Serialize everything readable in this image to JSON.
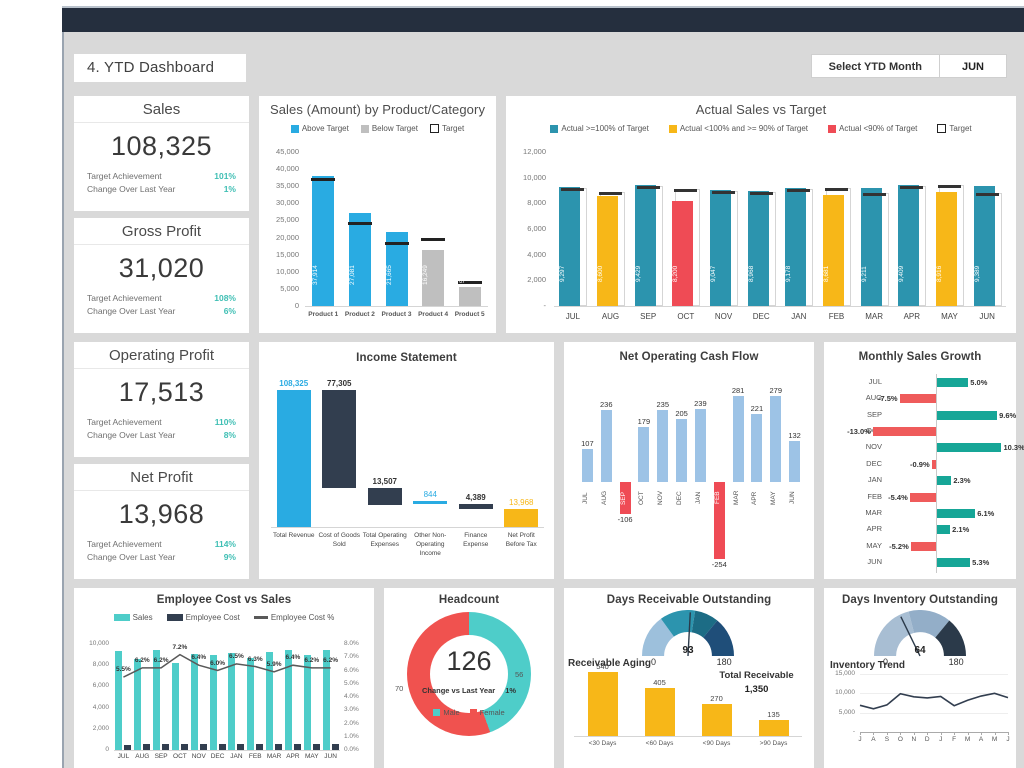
{
  "header": {
    "dashboard_title": "4. YTD Dashboard",
    "select_month_label": "Select YTD Month",
    "selected_month": "JUN"
  },
  "kpis": [
    {
      "name": "Sales",
      "value": "108,325",
      "target_label": "Target Achievement",
      "target_value": "101%",
      "change_label": "Change Over Last Year",
      "change_value": "1%"
    },
    {
      "name": "Gross Profit",
      "value": "31,020",
      "target_label": "Target Achievement",
      "target_value": "108%",
      "change_label": "Change Over Last Year",
      "change_value": "6%"
    },
    {
      "name": "Operating Profit",
      "value": "17,513",
      "target_label": "Target Achievement",
      "target_value": "110%",
      "change_label": "Change Over Last Year",
      "change_value": "8%"
    },
    {
      "name": "Net Profit",
      "value": "13,968",
      "target_label": "Target Achievement",
      "target_value": "114%",
      "change_label": "Change Over Last Year",
      "change_value": "9%"
    }
  ],
  "colors": {
    "blue": "#29abe2",
    "teal": "#2c94ae",
    "amber": "#f7b718",
    "red": "#ef4b55",
    "dark": "#323e4f",
    "green_teal": "#16a697",
    "cyan": "#4ecdc9",
    "light_blue": "#9dc3e6",
    "gray": "#bfbfbf",
    "navy": "#1f4e79"
  },
  "chart_data": [
    {
      "id": "sales-by-product",
      "type": "bar",
      "title": "Sales (Amount) by Product/Category",
      "legend": [
        "Above Target",
        "Below Target",
        "Target"
      ],
      "legend_position": "top",
      "categories": [
        "Product 1",
        "Product 2",
        "Product 3",
        "Product 4",
        "Product 5"
      ],
      "values": [
        37914,
        27081,
        21665,
        16249,
        5416
      ],
      "value_labels": [
        "37,914",
        "27,081",
        "21,665",
        "16,249",
        "5,416"
      ],
      "targets": [
        37500,
        24400,
        18600,
        19800,
        7300
      ],
      "status": [
        "above",
        "above",
        "above",
        "below",
        "below"
      ],
      "ylabel": "",
      "xlabel": "",
      "ylim": [
        0,
        45000
      ],
      "yticks": [
        "45,000",
        "40,000",
        "35,000",
        "30,000",
        "25,000",
        "20,000",
        "15,000",
        "10,000",
        "5,000",
        "0"
      ],
      "grid": false
    },
    {
      "id": "actual-sales-vs-target",
      "type": "bar",
      "title": "Actual Sales vs Target",
      "legend": [
        "Actual >=100% of Target",
        "Actual <100% and >= 90% of Target",
        "Actual <90% of Target",
        "Target"
      ],
      "legend_position": "top",
      "categories": [
        "JUL",
        "AUG",
        "SEP",
        "OCT",
        "NOV",
        "DEC",
        "JAN",
        "FEB",
        "MAR",
        "APR",
        "MAY",
        "JUN"
      ],
      "values": [
        9297,
        8600,
        9429,
        8200,
        9047,
        8968,
        9178,
        8681,
        9211,
        9409,
        8916,
        9389
      ],
      "value_labels": [
        "9,297",
        "8,600",
        "9,429",
        "8,200",
        "9,047",
        "8,968",
        "9,178",
        "8,681",
        "9,211",
        "9,409",
        "8,916",
        "9,389"
      ],
      "targets": [
        9180,
        8880,
        9340,
        9150,
        8960,
        8900,
        9120,
        9200,
        8830,
        9380,
        9440,
        8830
      ],
      "status": [
        "above",
        "mid",
        "above",
        "below",
        "above",
        "above",
        "above",
        "mid",
        "above",
        "above",
        "mid",
        "above"
      ],
      "ylim": [
        0,
        12000
      ],
      "yticks": [
        "12,000",
        "10,000",
        "8,000",
        "6,000",
        "4,000",
        "2,000",
        "-"
      ],
      "grid": false
    },
    {
      "id": "income-statement",
      "type": "bar",
      "title": "Income Statement",
      "categories": [
        "Total Revenue",
        "Cost of Goods Sold",
        "Total Operating Expenses",
        "Other Non-Operating Income",
        "Finance Expense",
        "Net Profit Before Tax"
      ],
      "values": [
        108325,
        77305,
        13507,
        844,
        4389,
        13968
      ],
      "value_labels": [
        "108,325",
        "77,305",
        "13,507",
        "844",
        "4,389",
        "13,968"
      ],
      "bar_colors": [
        "#29abe2",
        "#323e4f",
        "#323e4f",
        "#29abe2",
        "#323e4f",
        "#f7b718"
      ],
      "waterfall_base": [
        0,
        31020,
        17513,
        18357,
        13968,
        0
      ],
      "ylim": [
        0,
        108325
      ],
      "grid": false
    },
    {
      "id": "net-operating-cash-flow",
      "type": "bar",
      "title": "Net Operating Cash Flow",
      "categories": [
        "JUL",
        "AUG",
        "SEP",
        "OCT",
        "NOV",
        "DEC",
        "JAN",
        "FEB",
        "MAR",
        "APR",
        "MAY",
        "JUN"
      ],
      "values": [
        107,
        236,
        -106,
        179,
        235,
        205,
        239,
        -254,
        281,
        221,
        279,
        132
      ],
      "value_labels": [
        "107",
        "236",
        "-106",
        "179",
        "235",
        "205",
        "239",
        "-254",
        "281",
        "221",
        "279",
        "132"
      ],
      "positive_color": "#9dc3e6",
      "negative_color": "#ef4b55",
      "ylim": [
        -254,
        281
      ],
      "grid": false
    },
    {
      "id": "monthly-sales-growth",
      "type": "bar",
      "orientation": "horizontal",
      "title": "Monthly Sales Growth",
      "categories": [
        "JUL",
        "AUG",
        "SEP",
        "OCT",
        "NOV",
        "DEC",
        "JAN",
        "FEB",
        "MAR",
        "APR",
        "MAY",
        "JUN"
      ],
      "values": [
        5.0,
        -7.5,
        9.6,
        -13.0,
        10.3,
        -0.9,
        2.3,
        -5.4,
        6.1,
        2.1,
        -5.2,
        5.3
      ],
      "value_labels": [
        "5.0%",
        "-7.5%",
        "9.6%",
        "-13.0%",
        "10.3%",
        "-0.9%",
        "2.3%",
        "-5.4%",
        "6.1%",
        "2.1%",
        "-5.2%",
        "5.3%"
      ],
      "positive_color": "#16a697",
      "negative_color": "#ef5b5b",
      "ylim": [
        -13.0,
        10.3
      ],
      "grid": false
    },
    {
      "id": "employee-cost-vs-sales",
      "type": "bar",
      "title": "Employee Cost vs Sales",
      "legend": [
        "Sales",
        "Employee Cost",
        "Employee Cost %"
      ],
      "legend_position": "top",
      "categories": [
        "JUL",
        "AUG",
        "SEP",
        "OCT",
        "NOV",
        "DEC",
        "JAN",
        "FEB",
        "MAR",
        "APR",
        "MAY",
        "JUN"
      ],
      "series": [
        {
          "name": "Sales",
          "values": [
            9297,
            8600,
            9429,
            8200,
            9047,
            8968,
            9178,
            8681,
            9211,
            9409,
            8916,
            9389
          ],
          "color": "#4ecdc9"
        },
        {
          "name": "Employee Cost",
          "values": [
            511,
            533,
            585,
            590,
            579,
            538,
            597,
            547,
            543,
            602,
            553,
            582
          ],
          "color": "#323e4f"
        },
        {
          "name": "Employee Cost %",
          "values": [
            5.5,
            6.2,
            6.2,
            7.2,
            6.4,
            6.0,
            6.5,
            6.3,
            5.9,
            6.4,
            6.2,
            6.2
          ],
          "color": "#595959",
          "type": "line"
        }
      ],
      "pct_labels": [
        "5.5%",
        "6.2%",
        "6.2%",
        "7.2%",
        "6.4%",
        "6.0%",
        "6.5%",
        "6.3%",
        "5.9%",
        "6.4%",
        "6.2%",
        "6.2%"
      ],
      "yticks_left": [
        "10,000",
        "8,000",
        "6,000",
        "4,000",
        "2,000",
        "0"
      ],
      "yticks_right": [
        "8.0%",
        "7.0%",
        "6.0%",
        "5.0%",
        "4.0%",
        "3.0%",
        "2.0%",
        "1.0%",
        "0.0%"
      ],
      "ylim": [
        0,
        10000
      ],
      "ylim_right": [
        0,
        8.0
      ],
      "grid": false
    },
    {
      "id": "headcount",
      "type": "pie",
      "title": "Headcount",
      "center_value": "126",
      "change_label": "Change vs Last Year",
      "change_value": "1%",
      "legend": [
        "Male",
        "Female"
      ],
      "labels": [
        "Male",
        "Female"
      ],
      "values": [
        56,
        70
      ],
      "value_labels": [
        "56",
        "70"
      ],
      "colors": [
        "#4ecdc9",
        "#f0524f"
      ]
    },
    {
      "id": "days-receivable-outstanding",
      "type": "gauge",
      "title": "Days Receivable Outstanding",
      "value": 93,
      "value_label": "93",
      "min_label": "0",
      "max_label": "180",
      "ylim": [
        0,
        180
      ]
    },
    {
      "id": "receivable-aging",
      "type": "bar",
      "title": "Receivable Aging",
      "total_label": "Total Receivable",
      "total_value": "1,350",
      "categories": [
        "<30 Days",
        "<60 Days",
        "<90 Days",
        ">90 Days"
      ],
      "values": [
        540,
        405,
        270,
        135
      ],
      "value_labels": [
        "540",
        "405",
        "270",
        "135"
      ],
      "bar_color": "#f7b718",
      "ylim": [
        0,
        540
      ],
      "grid": false
    },
    {
      "id": "days-inventory-outstanding",
      "type": "gauge",
      "title": "Days Inventory Outstanding",
      "value": 64,
      "value_label": "64",
      "min_label": "0",
      "max_label": "180",
      "ylim": [
        0,
        180
      ]
    },
    {
      "id": "inventory-trend",
      "type": "line",
      "title": "Inventory Trend",
      "categories": [
        "J",
        "A",
        "S",
        "O",
        "N",
        "D",
        "J",
        "F",
        "M",
        "A",
        "M",
        "J"
      ],
      "values": [
        6900,
        6000,
        7000,
        9900,
        9100,
        8800,
        9200,
        6800,
        8200,
        9300,
        10000,
        8900
      ],
      "yticks": [
        "15,000",
        "10,000",
        "5,000",
        "-"
      ],
      "ylim": [
        0,
        15000
      ],
      "line_color": "#323e4f",
      "grid": true
    }
  ]
}
